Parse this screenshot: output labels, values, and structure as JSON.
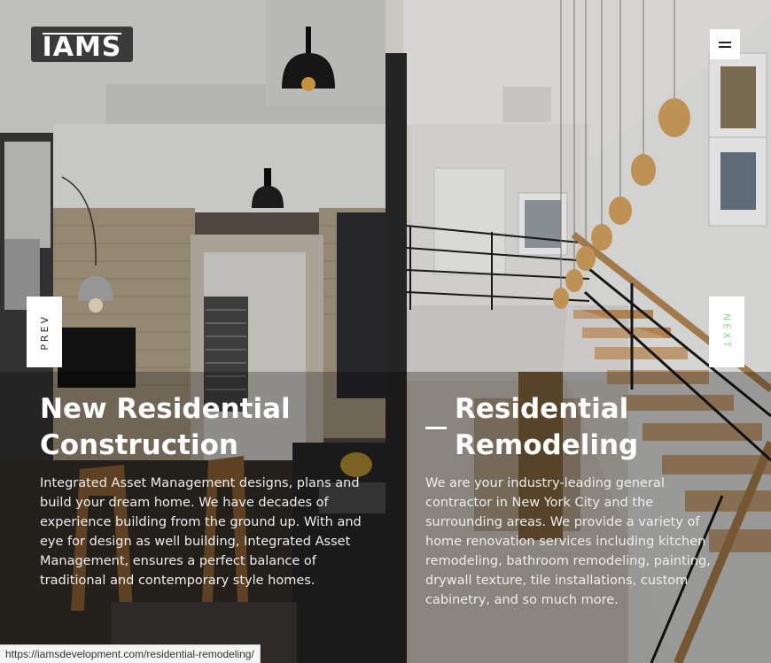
{
  "brand": {
    "logo_text": "IAMS"
  },
  "header": {
    "menu_icon": "hamburger-icon"
  },
  "nav": {
    "prev_label": "PREV",
    "next_label": "NEXT"
  },
  "slides": [
    {
      "title_line1": "New Residential",
      "title_line2": "Construction",
      "description": "Integrated Asset Management designs, plans and build your dream home. We have decades of experience building from the ground up. With and eye for design as well building, Integrated Asset Management, ensures a perfect balance of traditional and contemporary style homes."
    },
    {
      "title_line1": "Residential",
      "title_line2": "Remodeling",
      "description": "We are your industry-leading general contractor in New York City and the surrounding areas. We provide a variety of home renovation services including kitchen remodeling, bathroom remodeling, painting, drywall texture, tile installations, custom cabinetry, and so much more."
    }
  ],
  "status_bar": {
    "url": "https://iamsdevelopment.com/residential-remodeling/"
  },
  "colors": {
    "next_accent": "#8fd18f",
    "logo_bg": "#3a3a3a"
  }
}
